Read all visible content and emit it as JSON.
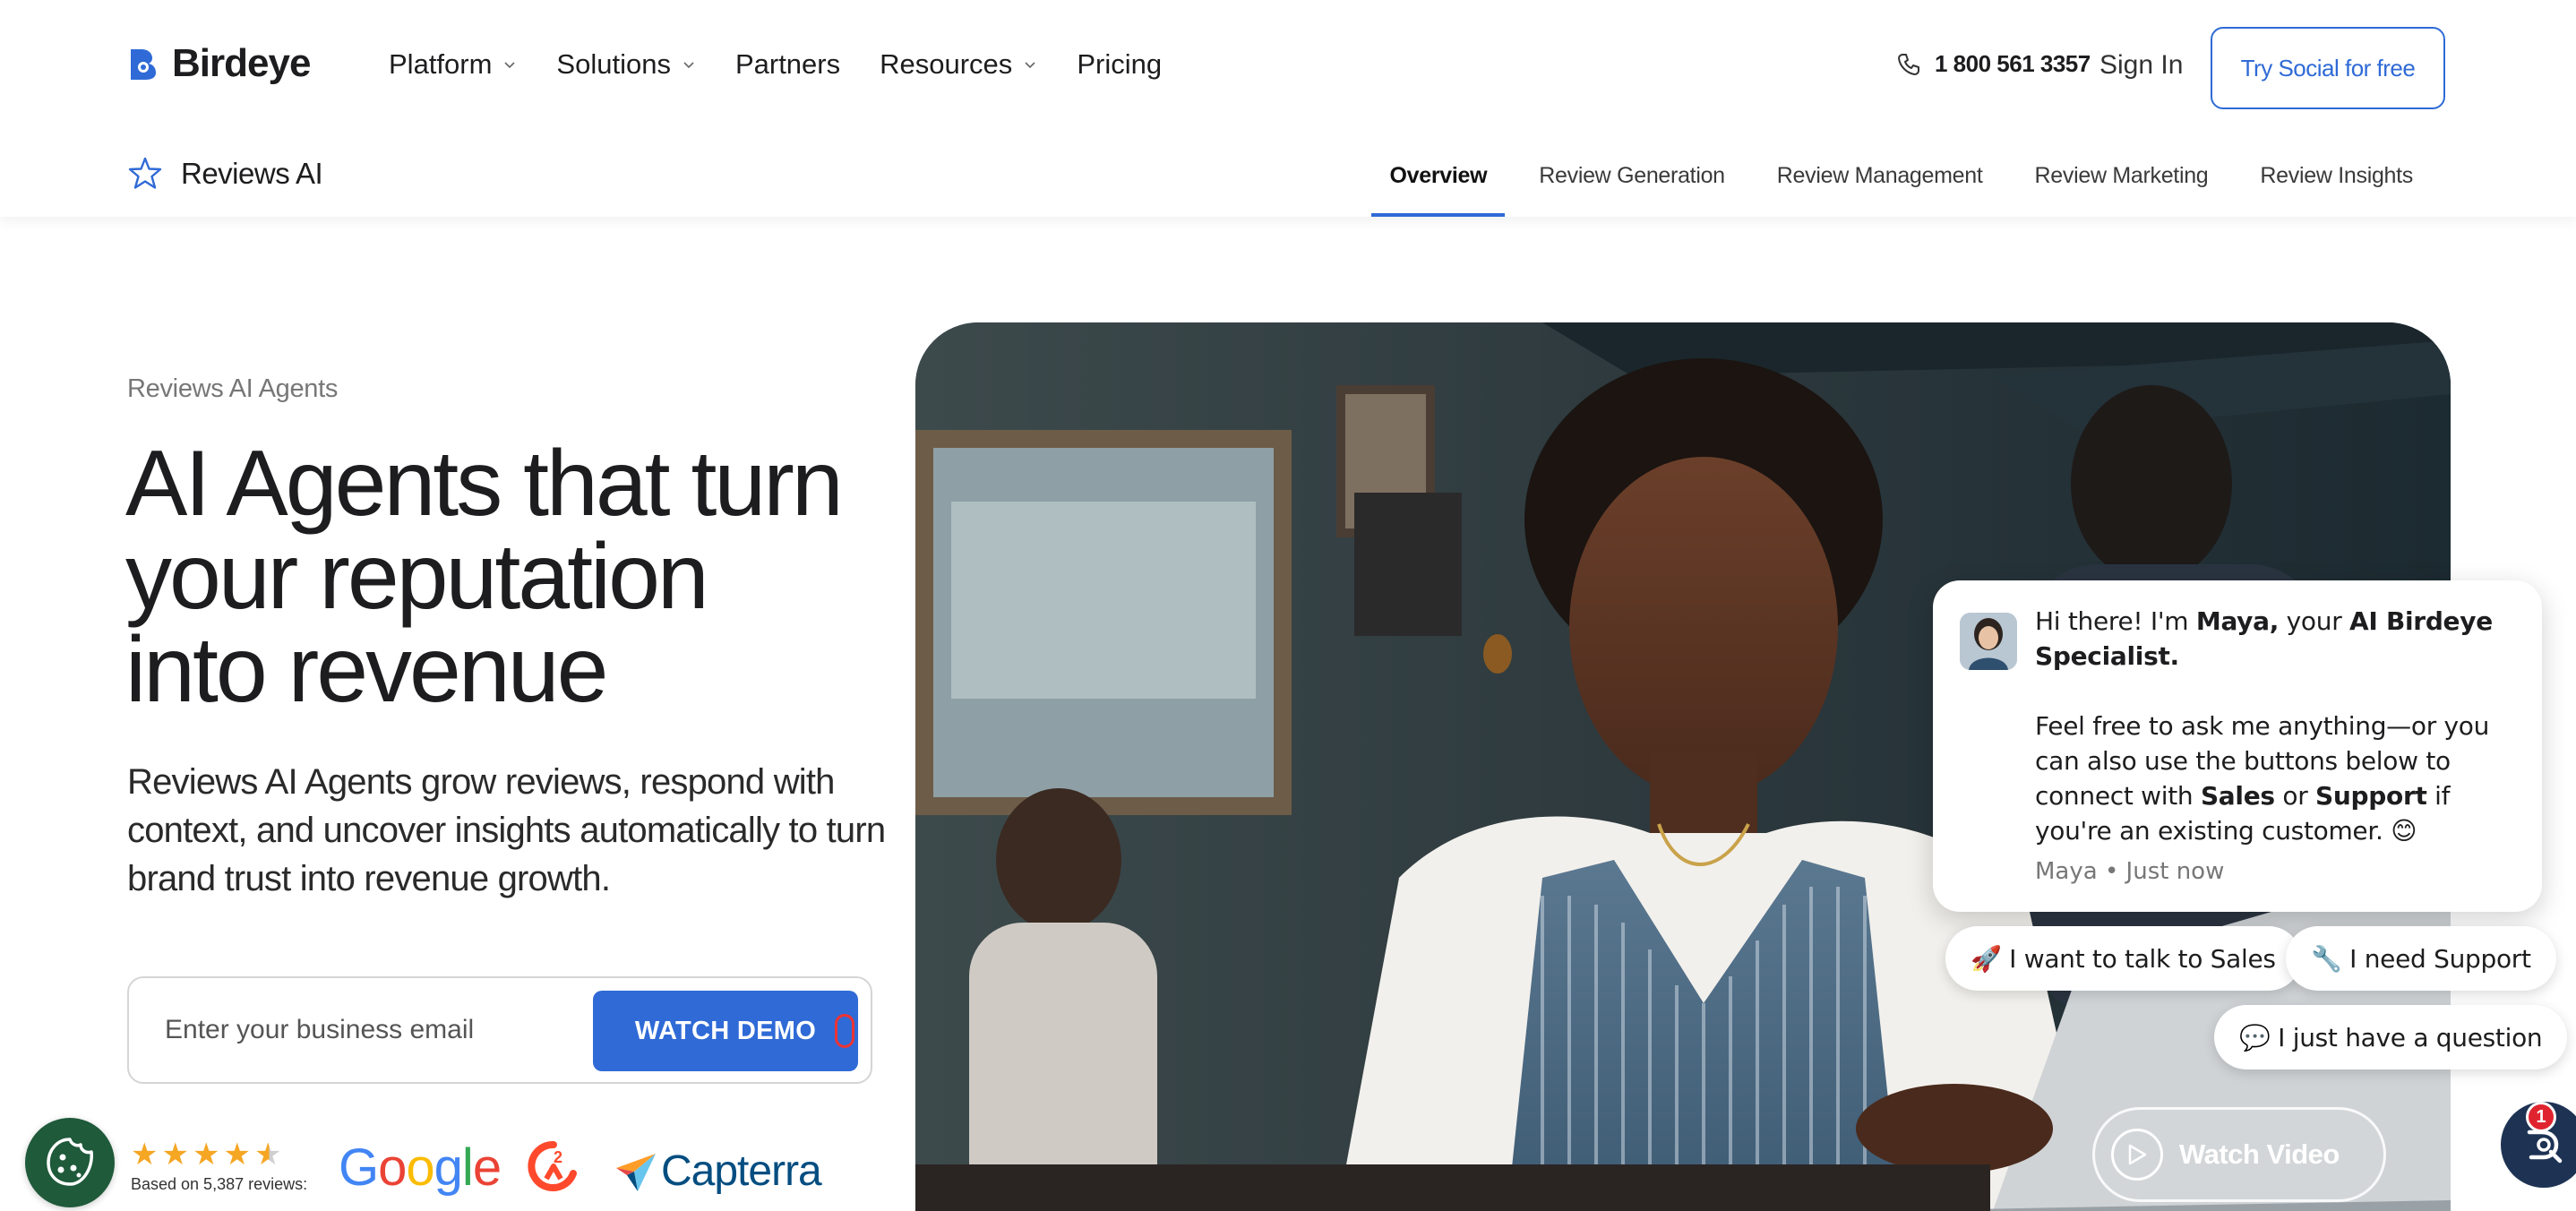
{
  "nav": {
    "logo_text": "Birdeye",
    "menu": [
      {
        "label": "Platform",
        "has_dropdown": true
      },
      {
        "label": "Solutions",
        "has_dropdown": true
      },
      {
        "label": "Partners",
        "has_dropdown": false
      },
      {
        "label": "Resources",
        "has_dropdown": true
      },
      {
        "label": "Pricing",
        "has_dropdown": false
      }
    ],
    "phone": "1 800 561 3357",
    "sign_in": "Sign In",
    "cta": "Try Social for free"
  },
  "subnav": {
    "title": "Reviews AI",
    "tabs": [
      {
        "label": "Overview",
        "active": true
      },
      {
        "label": "Review Generation",
        "active": false
      },
      {
        "label": "Review Management",
        "active": false
      },
      {
        "label": "Review Marketing",
        "active": false
      },
      {
        "label": "Review Insights",
        "active": false
      }
    ]
  },
  "hero": {
    "eyebrow": "Reviews AI Agents",
    "headline_lines": [
      "AI Agents that turn",
      "your reputation",
      "into revenue"
    ],
    "subcopy": "Reviews AI Agents grow reviews, respond with context, and uncover insights automatically to turn brand trust into revenue growth.",
    "email_placeholder": "Enter your business email",
    "demo_button": "WATCH DEMO",
    "rating_stars": 4.5,
    "rating_text": "Based on 5,387 reviews:",
    "review_brands": [
      "Google",
      "G2",
      "Capterra"
    ],
    "watch_video": "Watch Video"
  },
  "chat": {
    "greeting_prefix": "Hi there! I'm ",
    "agent_name": "Maya,",
    "greeting_mid": " your ",
    "agent_title": "AI Birdeye Specialist.",
    "body_prefix": "Feel free to ask me anything—or you can also use the buttons below to connect with ",
    "sales_word": "Sales",
    "or_word": " or ",
    "support_word": "Support",
    "body_suffix": " if you're an existing customer. 😊",
    "meta": "Maya • Just now",
    "chips": [
      "🚀 I want to talk to Sales",
      "🔧 I need Support",
      "💬 I just have a question"
    ],
    "badge_count": "1"
  },
  "colors": {
    "accent": "#2f6ad6",
    "text": "#1d1d1f",
    "star": "#f5a623",
    "launcher": "#1e3354",
    "badge": "#e0242f",
    "cookie": "#1f5a3a"
  }
}
